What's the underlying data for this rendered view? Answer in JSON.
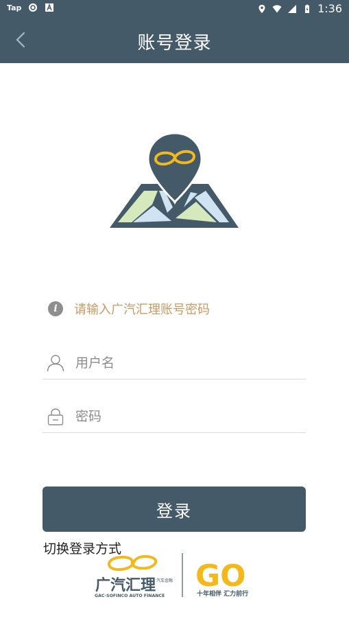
{
  "status_bar": {
    "app_label": "Tap",
    "time": "1:36"
  },
  "app_bar": {
    "title": "账号登录"
  },
  "hint": {
    "icon_glyph": "i",
    "text": "请输入广汽汇理账号密码"
  },
  "form": {
    "username_placeholder": "用户名",
    "username_value": "",
    "password_placeholder": "密码",
    "password_value": ""
  },
  "login_button": "登录",
  "switch_login": "切换登录方式",
  "brand": {
    "name": "广汽汇理",
    "subname": "汽车金融",
    "english": "GAC-SOFINCO AUTO FINANCE",
    "go_text": "GO",
    "slogan": "十年相伴 汇力前行"
  },
  "colors": {
    "primary": "#455a69",
    "hint_text": "#c89a63",
    "brand_gold": "#f3b81c"
  }
}
